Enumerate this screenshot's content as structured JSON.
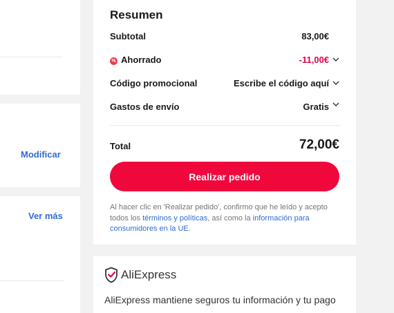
{
  "left_panel": {
    "modify_link": "Modificar",
    "see_more_link": "Ver más"
  },
  "summary": {
    "title": "Resumen",
    "subtotal": {
      "label": "Subtotal",
      "value": "83,00€"
    },
    "saved": {
      "badge": "%",
      "label": "Ahorrado",
      "value": "-11,00€"
    },
    "promo": {
      "label": "Código promocional",
      "value": "Escribe el código aquí"
    },
    "shipping": {
      "label": "Gastos de envío",
      "value": "Gratis"
    },
    "total": {
      "label": "Total",
      "value": "72,00€"
    },
    "place_order_label": "Realizar pedido",
    "legal": {
      "prefix": "Al hacer clic en 'Realizar pedido', confirmo que he leído y acepto todos los ",
      "terms_link": "términos y políticas",
      "middle": ", así como la ",
      "consumer_link": "información para consumidores en la UE",
      "suffix": "."
    }
  },
  "trust": {
    "brand": "AliExpress",
    "text": "AliExpress mantiene seguros tu información y tu pago"
  },
  "colors": {
    "accent_red": "#f0083d",
    "discount_red": "#e0004a",
    "link_blue": "#2e6bd6"
  },
  "icons": {
    "saved_badge": "discount-badge-icon",
    "dropdown": "chevron-down-icon",
    "brand_shield": "shield-check-icon"
  }
}
